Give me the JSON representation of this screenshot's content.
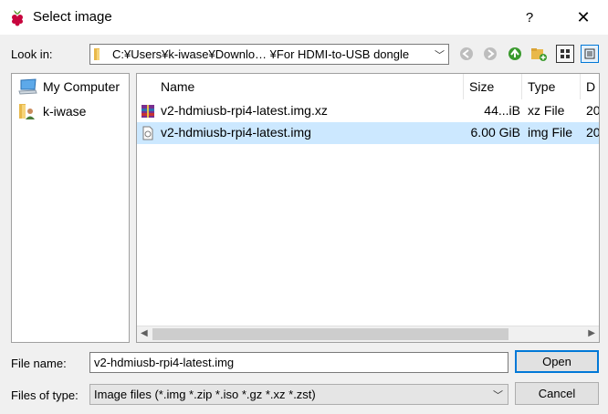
{
  "window": {
    "title": "Select image",
    "help_label": "?",
    "close_label": "✕"
  },
  "lookin": {
    "label": "Look in:",
    "path": "C:¥Users¥k-iwase¥Downlo… ¥For HDMI-to-USB dongle"
  },
  "toolbar": {
    "icons": [
      "back-icon",
      "forward-icon",
      "parent-folder-icon",
      "new-folder-icon",
      "list-view-icon",
      "detail-view-icon"
    ]
  },
  "sidebar": {
    "items": [
      {
        "label": "My Computer",
        "icon": "computer-icon"
      },
      {
        "label": "k-iwase",
        "icon": "user-folder-icon"
      }
    ]
  },
  "files": {
    "columns": [
      "Name",
      "Size",
      "Type",
      "D"
    ],
    "rows": [
      {
        "name": "v2-hdmiusb-rpi4-latest.img.xz",
        "size": "44...iB",
        "type": "xz File",
        "date": "20",
        "icon": "archive-icon",
        "selected": false
      },
      {
        "name": "v2-hdmiusb-rpi4-latest.img",
        "size": "6.00 GiB",
        "type": "img File",
        "date": "20",
        "icon": "image-file-icon",
        "selected": true
      }
    ]
  },
  "filename": {
    "label": "File name:",
    "value": "v2-hdmiusb-rpi4-latest.img"
  },
  "filetype": {
    "label": "Files of type:",
    "value": "Image files (*.img *.zip *.iso *.gz *.xz *.zst)"
  },
  "buttons": {
    "open": "Open",
    "cancel": "Cancel"
  },
  "colors": {
    "selection": "#cce8ff",
    "accent": "#0078d7"
  }
}
